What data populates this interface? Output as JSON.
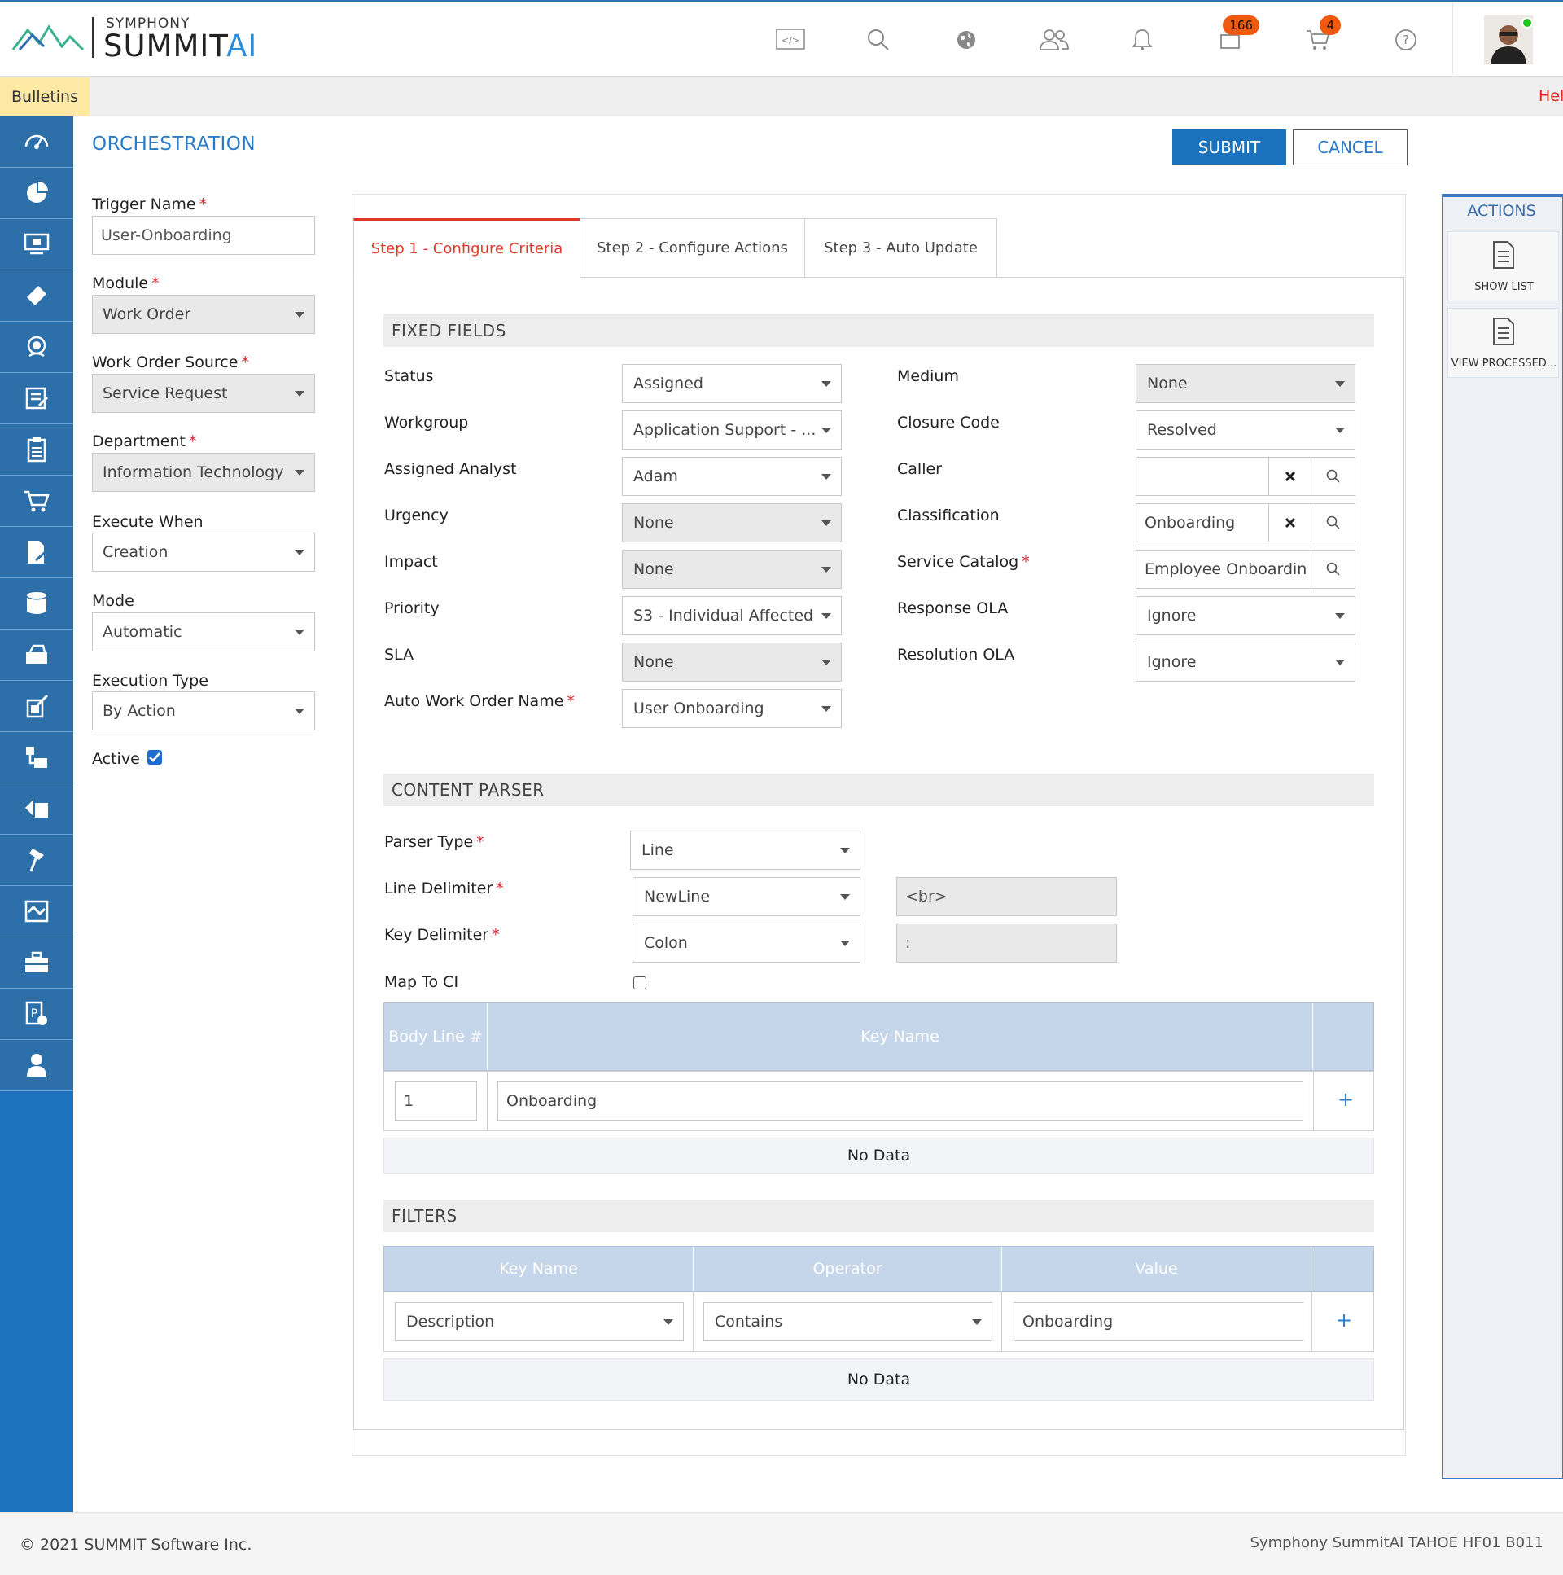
{
  "header": {
    "brand_small": "SYMPHONY",
    "brand_main": "SUMMIT",
    "brand_ai": "AI",
    "icons": [
      "code-icon",
      "search-icon",
      "globe-icon",
      "users-icon",
      "bell-icon",
      "mail-icon",
      "cart-icon",
      "help-icon"
    ],
    "mail_badge": "166",
    "cart_badge": "4"
  },
  "bulletin": {
    "label": "Bulletins",
    "ticker": "Hel"
  },
  "page": {
    "title": "ORCHESTRATION",
    "submit": "SUBMIT",
    "cancel": "CANCEL"
  },
  "left_form": {
    "trigger_name_label": "Trigger Name",
    "trigger_name_value": "User-Onboarding",
    "module_label": "Module",
    "module_value": "Work Order",
    "source_label": "Work Order Source",
    "source_value": "Service Request",
    "department_label": "Department",
    "department_value": "Information Technology",
    "execute_when_label": "Execute When",
    "execute_when_value": "Creation",
    "mode_label": "Mode",
    "mode_value": "Automatic",
    "execution_type_label": "Execution Type",
    "execution_type_value": "By Action",
    "active_label": "Active",
    "required_mark": "*"
  },
  "tabs": [
    "Step 1 - Configure Criteria",
    "Step 2 - Configure Actions",
    "Step 3 - Auto Update"
  ],
  "fixed_fields": {
    "title": "FIXED FIELDS",
    "status_label": "Status",
    "status_value": "Assigned",
    "workgroup_label": "Workgroup",
    "workgroup_value": "Application Support - ...",
    "analyst_label": "Assigned Analyst",
    "analyst_value": "Adam",
    "urgency_label": "Urgency",
    "urgency_value": "None",
    "impact_label": "Impact",
    "impact_value": "None",
    "priority_label": "Priority",
    "priority_value": "S3 - Individual Affected",
    "sla_label": "SLA",
    "sla_value": "None",
    "auto_wo_label": "Auto Work Order Name",
    "auto_wo_value": "User Onboarding",
    "medium_label": "Medium",
    "medium_value": "None",
    "closure_label": "Closure Code",
    "closure_value": "Resolved",
    "caller_label": "Caller",
    "caller_value": "",
    "classification_label": "Classification",
    "classification_value": "Onboarding",
    "catalog_label": "Service Catalog",
    "catalog_value": "Employee Onboarding",
    "response_ola_label": "Response OLA",
    "response_ola_value": "Ignore",
    "resolution_ola_label": "Resolution OLA",
    "resolution_ola_value": "Ignore"
  },
  "content_parser": {
    "title": "CONTENT PARSER",
    "parser_type_label": "Parser Type",
    "parser_type_value": "Line",
    "line_delim_label": "Line Delimiter",
    "line_delim_value": "NewLine",
    "line_delim_text": "<br>",
    "key_delim_label": "Key Delimiter",
    "key_delim_value": "Colon",
    "key_delim_text": ":",
    "map_ci_label": "Map To CI",
    "columns": [
      "Body Line #",
      "Key Name"
    ],
    "row": {
      "body_line": "1",
      "key_name": "Onboarding"
    },
    "no_data": "No Data"
  },
  "filters": {
    "title": "FILTERS",
    "columns": [
      "Key Name",
      "Operator",
      "Value"
    ],
    "row": {
      "key_name": "Description",
      "operator": "Contains",
      "value": "Onboarding"
    },
    "no_data": "No Data"
  },
  "actions_panel": {
    "title": "ACTIONS",
    "items": [
      "SHOW LIST",
      "VIEW PROCESSED..."
    ]
  },
  "footer": {
    "copyright": "© 2021 SUMMIT Software Inc.",
    "version": "Symphony SummitAI TAHOE HF01 B011"
  },
  "colors": {
    "primary": "#1b72bc",
    "nav": "#1f72be",
    "tab_active": "#e0392b",
    "required": "#d9232d",
    "badge": "#f05a0f"
  }
}
